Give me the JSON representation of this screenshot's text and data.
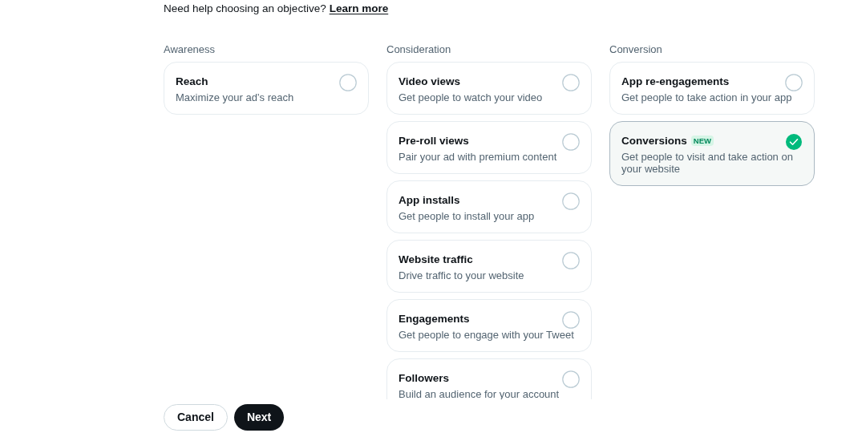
{
  "help": {
    "text": "Need help choosing an objective?",
    "link": "Learn more"
  },
  "columns": [
    {
      "label": "Awareness",
      "options": [
        {
          "title": "Reach",
          "description": "Maximize your ad’s reach",
          "selected": false
        }
      ]
    },
    {
      "label": "Consideration",
      "options": [
        {
          "title": "Video views",
          "description": "Get people to watch your video",
          "selected": false
        },
        {
          "title": "Pre-roll views",
          "description": "Pair your ad with premium content",
          "selected": false
        },
        {
          "title": "App installs",
          "description": "Get people to install your app",
          "selected": false
        },
        {
          "title": "Website traffic",
          "description": "Drive traffic to your website",
          "selected": false
        },
        {
          "title": "Engagements",
          "description": "Get people to engage with your Tweet",
          "selected": false
        },
        {
          "title": "Followers",
          "description": "Build an audience for your account",
          "selected": false
        }
      ]
    },
    {
      "label": "Conversion",
      "options": [
        {
          "title": "App re-engagements",
          "description": "Get people to take action in your app",
          "selected": false
        },
        {
          "title": "Conversions",
          "badge": "NEW",
          "description": "Get people to visit and take action on your website",
          "selected": true
        }
      ]
    }
  ],
  "buttons": {
    "cancel": "Cancel",
    "next": "Next"
  }
}
